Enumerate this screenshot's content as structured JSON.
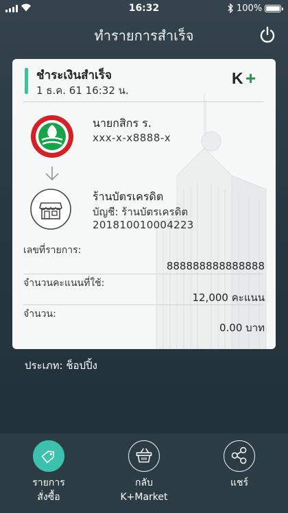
{
  "status_bar": {
    "time": "16:32",
    "battery_percent": "100%",
    "battery_level": 1.0
  },
  "header": {
    "title": "ทำรายการสำเร็จ",
    "power_icon": "power-icon"
  },
  "receipt": {
    "title": "ชำระเงินสำเร็จ",
    "datetime": "1 ธ.ค. 61  16:32 น.",
    "brand_logo": "K+",
    "accent_color": "#3ac29b",
    "brand_color": "#1f9a4a",
    "sender": {
      "name": "นายกสิกร ร.",
      "account": "xxx-x-x8888-x",
      "bank_logo_colors": [
        "#d71f26",
        "#16a34a"
      ]
    },
    "receiver": {
      "name": "ร้านบัตรเครดิต",
      "account": "บัญชี: ร้านบัตรเครดิต",
      "reference": "201810010004223"
    },
    "fields": [
      {
        "label": "เลขที่รายการ:",
        "value": "888888888888888"
      },
      {
        "label": "จำนวนคะแนนที่ใช้:",
        "value": "12,000 คะแนน"
      },
      {
        "label": "จำนวน:",
        "value": "0.00 บาท"
      }
    ]
  },
  "category": "ประเภท: ช็อปปิ้ง",
  "bottom_bar": {
    "active_color": "#3cc1ad",
    "items": [
      {
        "label_line1": "รายการ",
        "label_line2": "สั่งซื้อ",
        "icon": "tag-icon",
        "active": true
      },
      {
        "label_line1": "กลับ",
        "label_line2": "K+Market",
        "icon": "basket-icon",
        "active": false
      },
      {
        "label_line1": "แชร์",
        "label_line2": "",
        "icon": "share-icon",
        "active": false
      }
    ]
  }
}
